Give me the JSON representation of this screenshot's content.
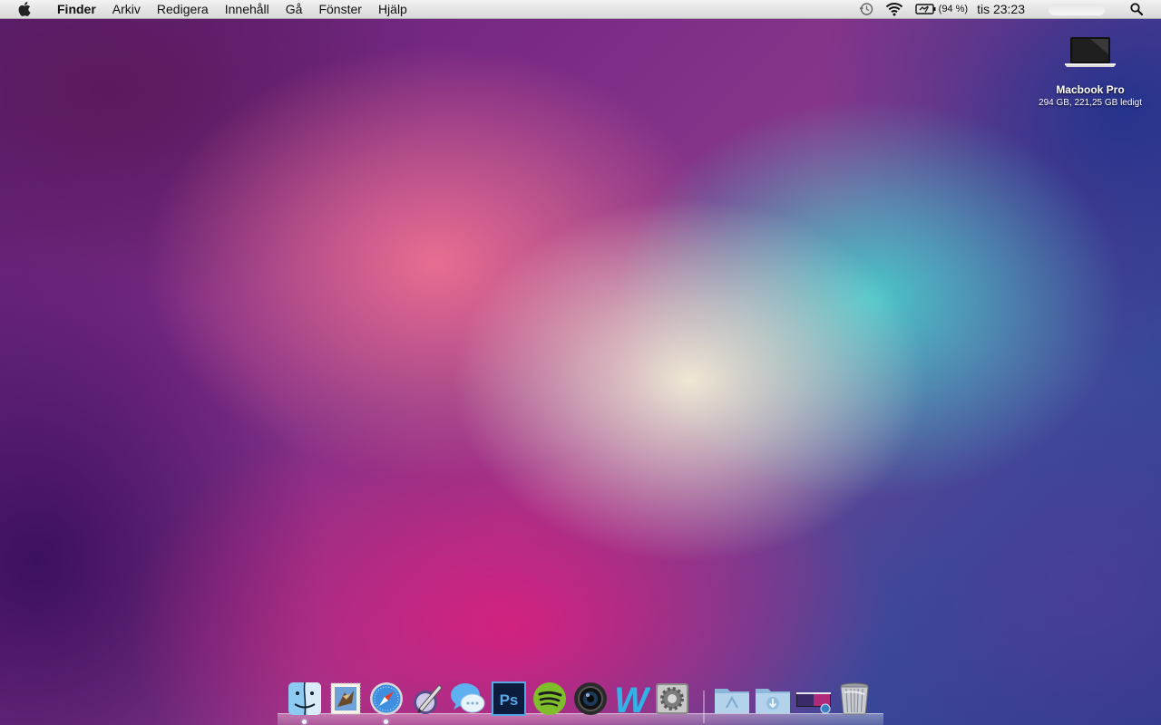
{
  "menubar": {
    "apple_icon": "apple-icon",
    "app_name": "Finder",
    "items": [
      "Arkiv",
      "Redigera",
      "Innehåll",
      "Gå",
      "Fönster",
      "Hjälp"
    ],
    "battery_percent": "(94 %)",
    "clock": "tis 23:23",
    "tray_icons": [
      "time-machine-icon",
      "wifi-icon",
      "battery-icon",
      "spotlight-icon"
    ]
  },
  "desktop": {
    "drive": {
      "name": "Macbook Pro",
      "info": "294 GB, 221,25 GB ledigt",
      "icon": "laptop-icon"
    }
  },
  "dock": {
    "items": [
      {
        "icon": "finder-icon",
        "running": true
      },
      {
        "icon": "mail-icon",
        "running": false
      },
      {
        "icon": "safari-icon",
        "running": true
      },
      {
        "icon": "script-editor-icon",
        "running": false
      },
      {
        "icon": "messages-icon",
        "running": false
      },
      {
        "icon": "photoshop-icon",
        "running": false,
        "label": "Ps"
      },
      {
        "icon": "spotify-icon",
        "running": false
      },
      {
        "icon": "camera-icon",
        "running": false
      },
      {
        "icon": "word-w-icon",
        "running": false,
        "label": "W"
      },
      {
        "icon": "system-preferences-icon",
        "running": false
      },
      {
        "icon": "applications-folder-icon",
        "running": false
      },
      {
        "icon": "downloads-folder-icon",
        "running": false
      },
      {
        "icon": "stack-image-icon",
        "running": false
      },
      {
        "icon": "trash-icon",
        "running": false
      }
    ]
  },
  "colors": {
    "menubar_top": "#f2f2f2",
    "menubar_bottom": "#d9d9d9",
    "wallpaper_pink": "#ee7091",
    "wallpaper_teal": "#46cdcd",
    "wallpaper_magenta": "#dc1e7d",
    "wallpaper_purple": "#5a2074"
  }
}
